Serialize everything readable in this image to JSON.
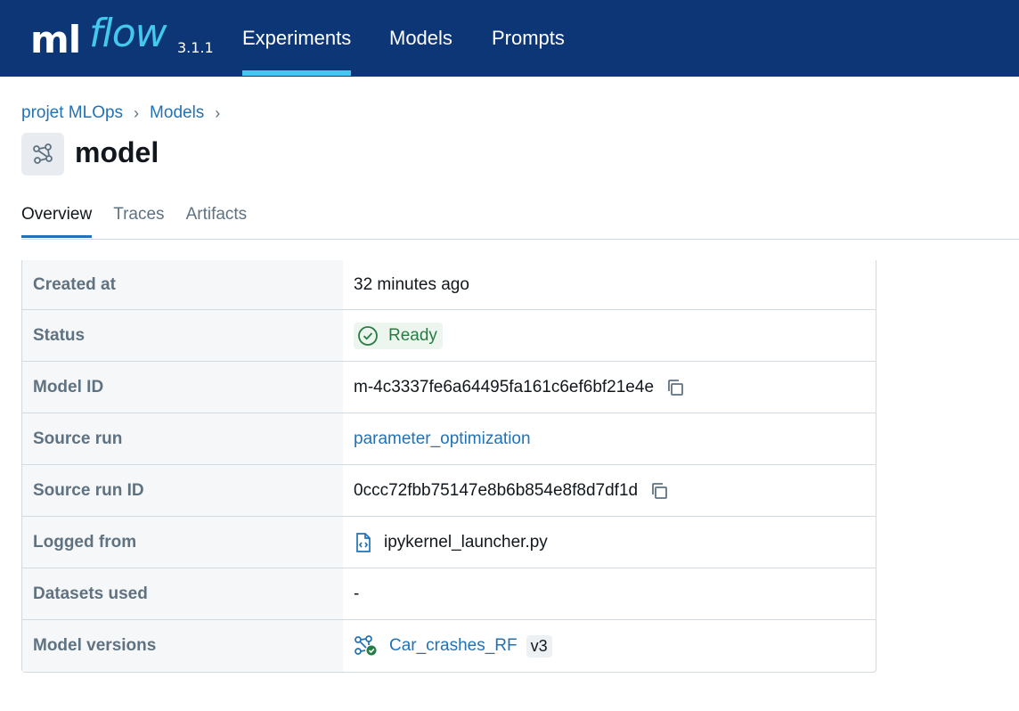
{
  "app": {
    "logo_ml": "ml",
    "logo_flow": "flow",
    "version": "3.1.1",
    "nav": [
      {
        "label": "Experiments",
        "active": true
      },
      {
        "label": "Models",
        "active": false
      },
      {
        "label": "Prompts",
        "active": false
      }
    ]
  },
  "breadcrumb": [
    "projet MLOps",
    "Models"
  ],
  "page": {
    "title": "model",
    "icon": "model-icon"
  },
  "tabs": [
    {
      "label": "Overview",
      "active": true
    },
    {
      "label": "Traces",
      "active": false
    },
    {
      "label": "Artifacts",
      "active": false
    }
  ],
  "details": {
    "created_at": {
      "key": "Created at",
      "value": "32 minutes ago"
    },
    "status": {
      "key": "Status",
      "value": "Ready",
      "icon": "check-circle-icon"
    },
    "model_id": {
      "key": "Model ID",
      "value": "m-4c3337fe6a64495fa161c6ef6bf21e4e",
      "icon": "copy-icon"
    },
    "source_run": {
      "key": "Source run",
      "value": "parameter_optimization"
    },
    "source_run_id": {
      "key": "Source run ID",
      "value": "0ccc72fbb75147e8b6b854e8f8d7df1d",
      "icon": "copy-icon"
    },
    "logged_from": {
      "key": "Logged from",
      "value": "ipykernel_launcher.py",
      "icon": "code-file-icon"
    },
    "datasets_used": {
      "key": "Datasets used",
      "value": "-"
    },
    "model_versions": {
      "key": "Model versions",
      "value": "Car_crashes_RF",
      "version": "v3",
      "icon": "registered-model-icon"
    }
  },
  "colors": {
    "topbar": "#0d3677",
    "accent": "#43c9ed",
    "link": "#2272b4",
    "status_ready": "#277c43"
  }
}
